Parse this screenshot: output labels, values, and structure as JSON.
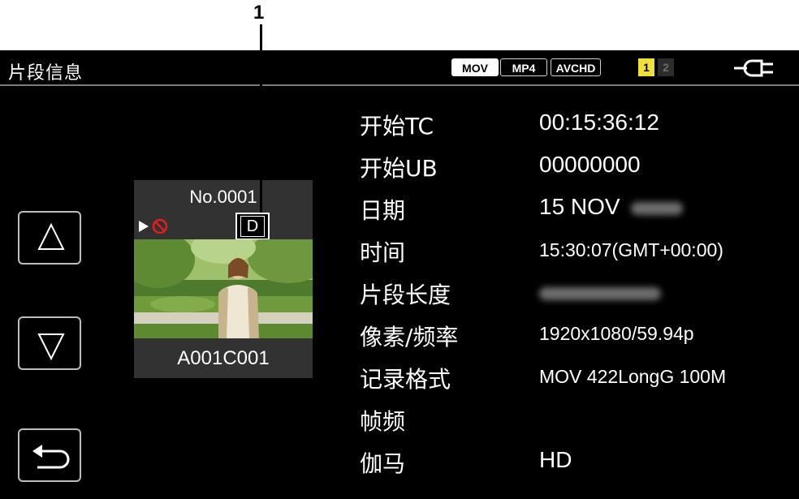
{
  "callout": {
    "number": "1"
  },
  "header": {
    "title": "片段信息",
    "formats": [
      "MOV",
      "MP4",
      "AVCHD"
    ],
    "active_format": "MOV",
    "slot1": "1",
    "slot2": "2",
    "power_icon": "ac-power-plug-icon"
  },
  "thumbnail": {
    "clip_number": "No.0001",
    "badge": "D",
    "clip_name": "A001C001",
    "play_icon": "play-icon",
    "protect_icon": "prohibited-icon"
  },
  "nav": {
    "up_icon": "triangle-up-icon",
    "down_icon": "triangle-down-icon",
    "back_icon": "return-arrow-icon"
  },
  "info": {
    "rows": [
      {
        "label": "开始TC",
        "value": "00:15:36:12"
      },
      {
        "label": "开始UB",
        "value": "00000000"
      },
      {
        "label": "日期",
        "value": "15 NOV"
      },
      {
        "label": "时间",
        "value": "15:30:07(GMT+00:00)"
      },
      {
        "label": "片段长度",
        "value": ""
      },
      {
        "label": "像素/频率",
        "value": "1920x1080/59.94p"
      },
      {
        "label": "记录格式",
        "value": "MOV 422LongG 100M"
      },
      {
        "label": "帧频",
        "value": ""
      },
      {
        "label": "伽马",
        "value": "HD"
      }
    ]
  },
  "colors": {
    "background": "#000000",
    "slot_active": "#f2e03a",
    "thumb_bg": "#323232",
    "prohibit_red": "#e0201e"
  }
}
